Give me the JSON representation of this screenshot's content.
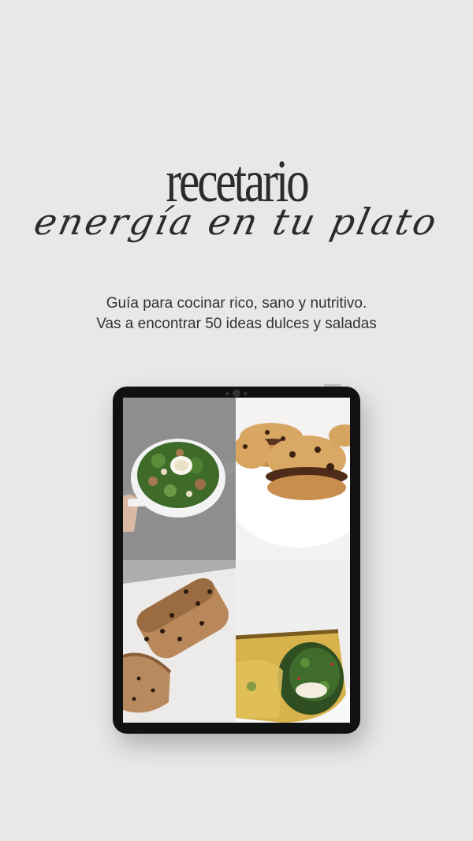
{
  "header": {
    "title": "recetario",
    "subtitle": "energía en tu plato"
  },
  "description": {
    "line1": "Guía para cocinar rico, sano y nutritivo.",
    "line2": "Vas a encontrar 50 ideas dulces y saladas"
  },
  "tablet": {
    "tiles": [
      "salad",
      "cookie-sandwiches",
      "chocolate-chip-loaf",
      "spinach-wrap"
    ]
  },
  "colors": {
    "background": "#e8e8e8",
    "text": "#2b2b2b",
    "device": "#111111"
  }
}
